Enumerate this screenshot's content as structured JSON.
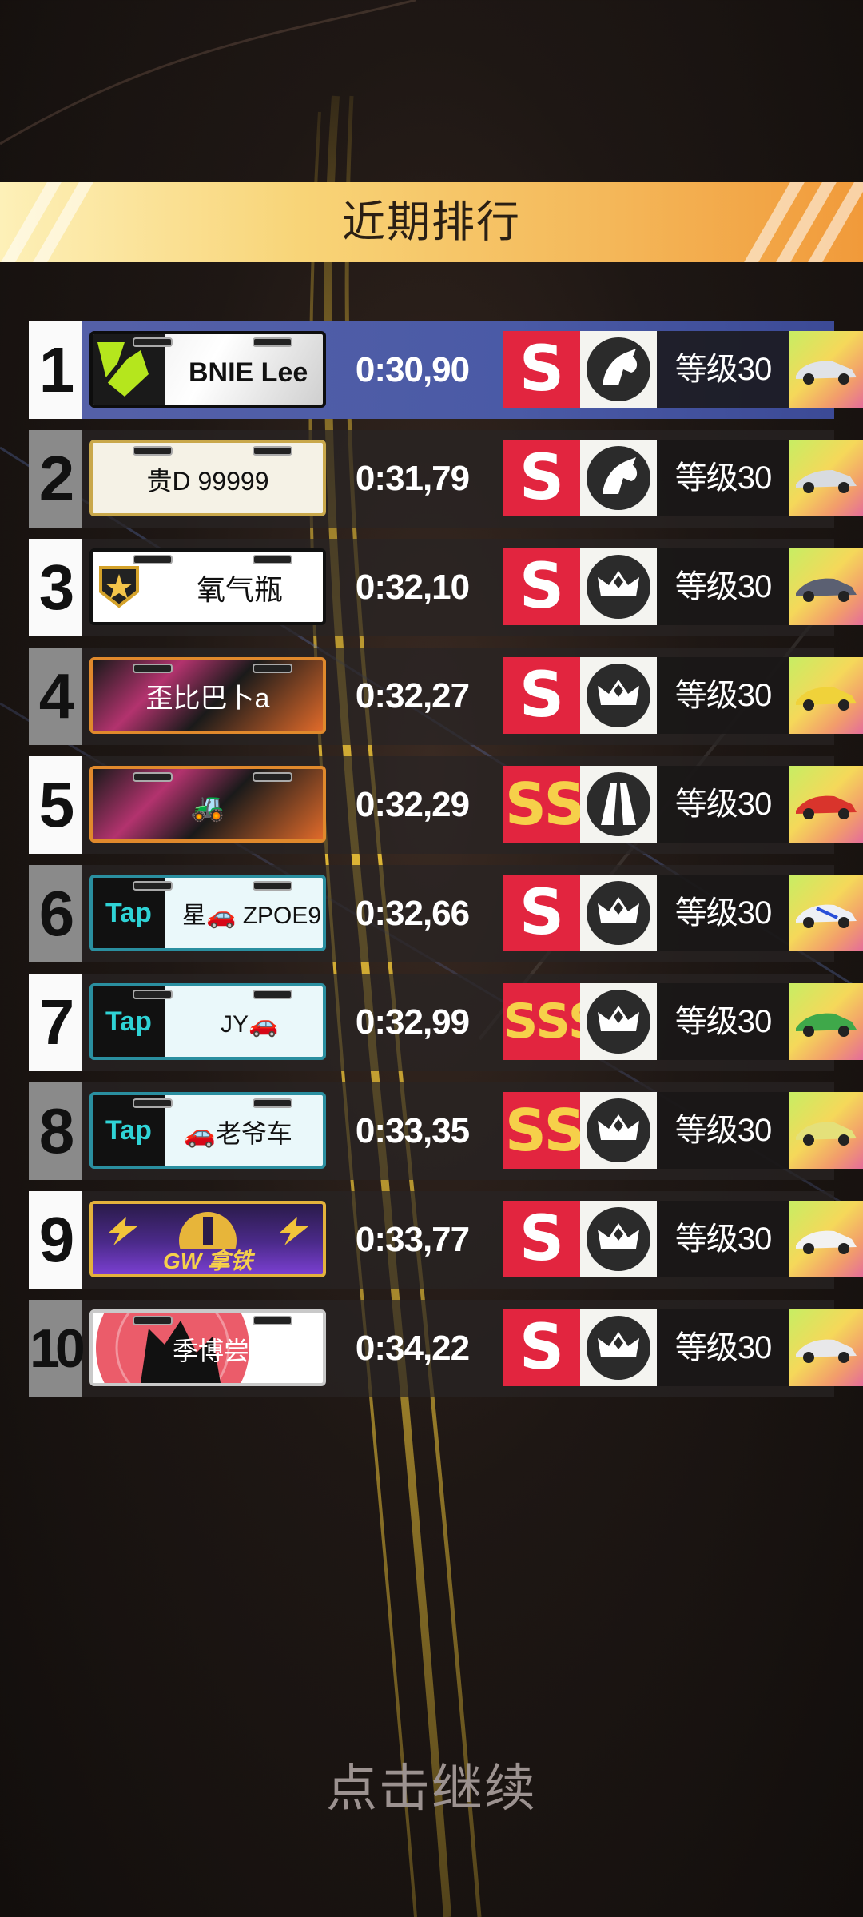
{
  "header": {
    "title": "近期排行"
  },
  "leaderboard": [
    {
      "rank": "1",
      "plate": "BNIE Lee",
      "time": "0:30,90",
      "grade": "S",
      "emblem": "horse-icon",
      "level": "等级30"
    },
    {
      "rank": "2",
      "plate": "贵D 99999",
      "time": "0:31,79",
      "grade": "S",
      "emblem": "horse-icon",
      "level": "等级30"
    },
    {
      "rank": "3",
      "plate": "氧气瓶",
      "time": "0:32,10",
      "grade": "S",
      "emblem": "crown-icon",
      "level": "等级30"
    },
    {
      "rank": "4",
      "plate": "歪比巴卜a",
      "time": "0:32,27",
      "grade": "S",
      "emblem": "crown-icon",
      "level": "等级30"
    },
    {
      "rank": "5",
      "plate": "🚜",
      "time": "0:32,29",
      "grade": "SS",
      "emblem": "road-icon",
      "level": "等级30"
    },
    {
      "rank": "6",
      "plate": "星🚗 ZPOE9",
      "plate_logo": "Tap",
      "time": "0:32,66",
      "grade": "S",
      "emblem": "crown-icon",
      "level": "等级30"
    },
    {
      "rank": "7",
      "plate": "JY🚗",
      "plate_logo": "Tap",
      "time": "0:32,99",
      "grade": "SSS",
      "emblem": "crown-icon",
      "level": "等级30"
    },
    {
      "rank": "8",
      "plate": "🚗老爷车",
      "plate_logo": "Tap",
      "time": "0:33,35",
      "grade": "SS",
      "emblem": "crown-icon",
      "level": "等级30"
    },
    {
      "rank": "9",
      "plate": "GW 拿铁",
      "time": "0:33,77",
      "grade": "S",
      "emblem": "crown-icon",
      "level": "等级30"
    },
    {
      "rank": "10",
      "plate": "季博尝",
      "time": "0:34,22",
      "grade": "S",
      "emblem": "crown-icon",
      "level": "等级30"
    }
  ],
  "footer": {
    "continue_label": "点击继续"
  },
  "colors": {
    "banner": "#f8d477",
    "grade_badge": "#e2253f",
    "first_row": "#4a5aa6"
  }
}
